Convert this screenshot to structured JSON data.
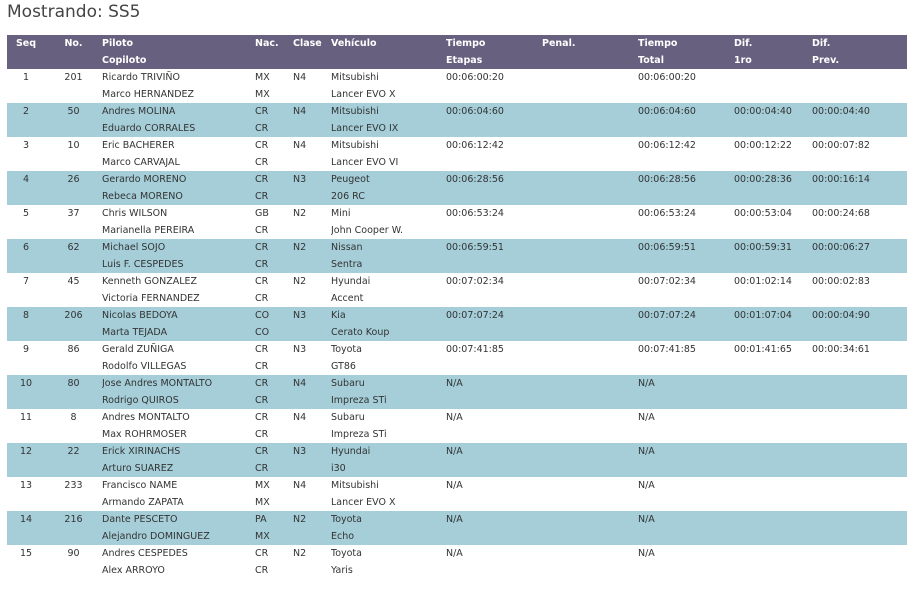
{
  "title": "Mostrando: SS5",
  "headers": {
    "seq": "Seq",
    "num": "No.",
    "piloto": "Piloto",
    "copiloto": "Copiloto",
    "nac": "Nac.",
    "clase": "Clase",
    "vehiculo": "Vehículo",
    "tiempo1": "Tiempo",
    "tiempo2": "Etapas",
    "penal": "Penal.",
    "total1": "Tiempo",
    "total2": "Total",
    "dif1a": "Dif.",
    "dif1b": "1ro",
    "dif2a": "Dif.",
    "dif2b": "Prev."
  },
  "entries": [
    {
      "seq": "1",
      "num": "201",
      "piloto": "Ricardo TRIVIÑO",
      "nac1": "MX",
      "copiloto": "Marco HERNANDEZ",
      "nac2": "MX",
      "clase": "N4",
      "veh1": "Mitsubishi",
      "veh2": "Lancer EVO X",
      "tiempo": "00:06:00:20",
      "penal": "",
      "total": "00:06:00:20",
      "dif1": "",
      "dif2": ""
    },
    {
      "seq": "2",
      "num": "50",
      "piloto": "Andres MOLINA",
      "nac1": "CR",
      "copiloto": "Eduardo CORRALES",
      "nac2": "CR",
      "clase": "N4",
      "veh1": "Mitsubishi",
      "veh2": "Lancer EVO IX",
      "tiempo": "00:06:04:60",
      "penal": "",
      "total": "00:06:04:60",
      "dif1": "00:00:04:40",
      "dif2": "00:00:04:40"
    },
    {
      "seq": "3",
      "num": "10",
      "piloto": "Eric BACHERER",
      "nac1": "CR",
      "copiloto": "Marco CARVAJAL",
      "nac2": "CR",
      "clase": "N4",
      "veh1": "Mitsubishi",
      "veh2": "Lancer EVO VI",
      "tiempo": "00:06:12:42",
      "penal": "",
      "total": "00:06:12:42",
      "dif1": "00:00:12:22",
      "dif2": "00:00:07:82"
    },
    {
      "seq": "4",
      "num": "26",
      "piloto": "Gerardo MORENO",
      "nac1": "CR",
      "copiloto": "Rebeca MORENO",
      "nac2": "CR",
      "clase": "N3",
      "veh1": "Peugeot",
      "veh2": "206 RC",
      "tiempo": "00:06:28:56",
      "penal": "",
      "total": "00:06:28:56",
      "dif1": "00:00:28:36",
      "dif2": "00:00:16:14"
    },
    {
      "seq": "5",
      "num": "37",
      "piloto": "Chris WILSON",
      "nac1": "GB",
      "copiloto": "Marianella PEREIRA",
      "nac2": "CR",
      "clase": "N2",
      "veh1": "Mini",
      "veh2": "John Cooper W.",
      "tiempo": "00:06:53:24",
      "penal": "",
      "total": "00:06:53:24",
      "dif1": "00:00:53:04",
      "dif2": "00:00:24:68"
    },
    {
      "seq": "6",
      "num": "62",
      "piloto": "Michael SOJO",
      "nac1": "CR",
      "copiloto": "Luis F. CESPEDES",
      "nac2": "CR",
      "clase": "N2",
      "veh1": "Nissan",
      "veh2": "Sentra",
      "tiempo": "00:06:59:51",
      "penal": "",
      "total": "00:06:59:51",
      "dif1": "00:00:59:31",
      "dif2": "00:00:06:27"
    },
    {
      "seq": "7",
      "num": "45",
      "piloto": "Kenneth GONZALEZ",
      "nac1": "CR",
      "copiloto": "Victoria FERNANDEZ",
      "nac2": "CR",
      "clase": "N2",
      "veh1": "Hyundai",
      "veh2": "Accent",
      "tiempo": "00:07:02:34",
      "penal": "",
      "total": "00:07:02:34",
      "dif1": "00:01:02:14",
      "dif2": "00:00:02:83"
    },
    {
      "seq": "8",
      "num": "206",
      "piloto": "Nicolas BEDOYA",
      "nac1": "CO",
      "copiloto": "Marta TEJADA",
      "nac2": "CO",
      "clase": "N3",
      "veh1": "Kia",
      "veh2": "Cerato Koup",
      "tiempo": "00:07:07:24",
      "penal": "",
      "total": "00:07:07:24",
      "dif1": "00:01:07:04",
      "dif2": "00:00:04:90"
    },
    {
      "seq": "9",
      "num": "86",
      "piloto": "Gerald ZUÑIGA",
      "nac1": "CR",
      "copiloto": "Rodolfo VILLEGAS",
      "nac2": "CR",
      "clase": "N3",
      "veh1": "Toyota",
      "veh2": "GT86",
      "tiempo": "00:07:41:85",
      "penal": "",
      "total": "00:07:41:85",
      "dif1": "00:01:41:65",
      "dif2": "00:00:34:61"
    },
    {
      "seq": "10",
      "num": "80",
      "piloto": "Jose Andres MONTALTO",
      "nac1": "CR",
      "copiloto": "Rodrigo QUIROS",
      "nac2": "CR",
      "clase": "N4",
      "veh1": "Subaru",
      "veh2": "Impreza STi",
      "tiempo": "N/A",
      "penal": "",
      "total": "N/A",
      "dif1": "",
      "dif2": ""
    },
    {
      "seq": "11",
      "num": "8",
      "piloto": "Andres MONTALTO",
      "nac1": "CR",
      "copiloto": "Max ROHRMOSER",
      "nac2": "CR",
      "clase": "N4",
      "veh1": "Subaru",
      "veh2": "Impreza STi",
      "tiempo": "N/A",
      "penal": "",
      "total": "N/A",
      "dif1": "",
      "dif2": ""
    },
    {
      "seq": "12",
      "num": "22",
      "piloto": "Erick XIRINACHS",
      "nac1": "CR",
      "copiloto": "Arturo SUAREZ",
      "nac2": "CR",
      "clase": "N3",
      "veh1": "Hyundai",
      "veh2": "i30",
      "tiempo": "N/A",
      "penal": "",
      "total": "N/A",
      "dif1": "",
      "dif2": ""
    },
    {
      "seq": "13",
      "num": "233",
      "piloto": "Francisco NAME",
      "nac1": "MX",
      "copiloto": "Armando ZAPATA",
      "nac2": "MX",
      "clase": "N4",
      "veh1": "Mitsubishi",
      "veh2": "Lancer EVO X",
      "tiempo": "N/A",
      "penal": "",
      "total": "N/A",
      "dif1": "",
      "dif2": ""
    },
    {
      "seq": "14",
      "num": "216",
      "piloto": "Dante PESCETO",
      "nac1": "PA",
      "copiloto": "Alejandro DOMINGUEZ",
      "nac2": "MX",
      "clase": "N2",
      "veh1": "Toyota",
      "veh2": "Echo",
      "tiempo": "N/A",
      "penal": "",
      "total": "N/A",
      "dif1": "",
      "dif2": ""
    },
    {
      "seq": "15",
      "num": "90",
      "piloto": "Andres CESPEDES",
      "nac1": "CR",
      "copiloto": "Alex ARROYO",
      "nac2": "CR",
      "clase": "N2",
      "veh1": "Toyota",
      "veh2": "Yaris",
      "tiempo": "N/A",
      "penal": "",
      "total": "N/A",
      "dif1": "",
      "dif2": ""
    }
  ],
  "colors": {
    "header_bg": "#67617f",
    "row_alt_bg": "#a5ced9",
    "header_text": "#ffffff"
  }
}
